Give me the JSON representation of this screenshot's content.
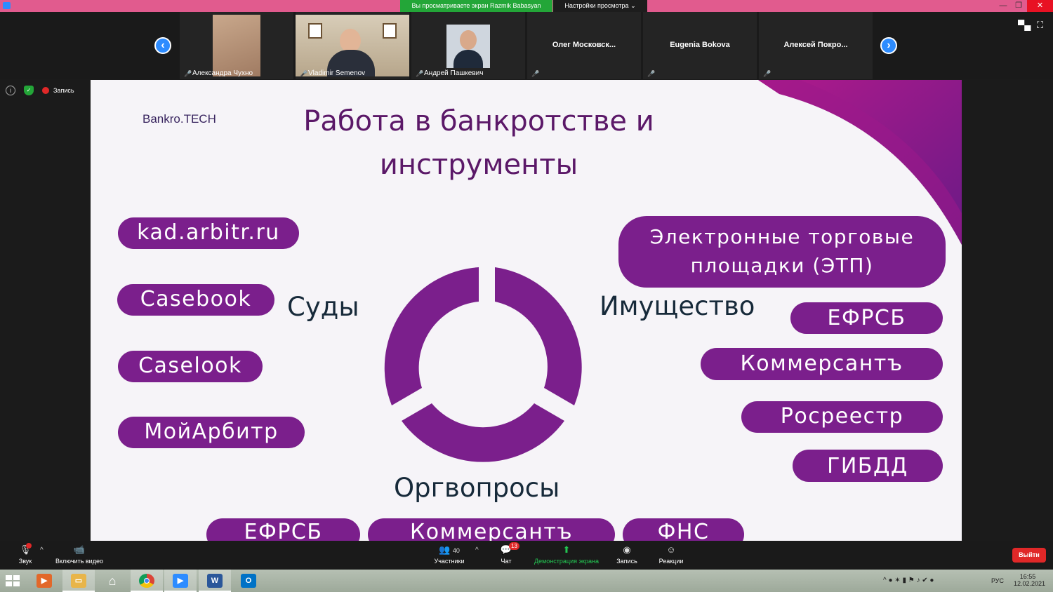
{
  "window": {
    "share_banner": "Вы просматриваете экран Razmik Babasyan",
    "view_options": "Настройки просмотра",
    "minimize": "—",
    "restore": "❐",
    "close": "✕"
  },
  "gallery": {
    "participants": [
      {
        "name": "Александра Чухно",
        "video": true
      },
      {
        "name": "Vladimir Semenov",
        "video": true
      },
      {
        "name": "Андрей Пашкевич",
        "video": true
      },
      {
        "name": "Олег  Московск...",
        "video": false
      },
      {
        "name": "Eugenia Bokova",
        "video": false
      },
      {
        "name": "Алексей  Покро...",
        "video": false
      }
    ]
  },
  "status": {
    "recording_label": "Запись"
  },
  "slide": {
    "logo": "Bankro.TECH",
    "title_line1": "Работа в банкротстве и",
    "title_line2": "инструменты",
    "courts_label": "Суды",
    "property_label": "Имущество",
    "org_label": "Оргвопросы",
    "courts_pills": [
      "kad.arbitr.ru",
      "Casebook",
      "Caselook",
      "МойАрбитр"
    ],
    "property_pills": [
      "Электронные торговые",
      "площадки (ЭТП)",
      "ЕФРСБ",
      "Коммерсантъ",
      "Росреестр",
      "ГИБДД"
    ],
    "org_pills": [
      "ЕФРСБ",
      "Коммерсантъ",
      "ФНС"
    ],
    "accent_color": "#7b1f8c"
  },
  "toolbar": {
    "audio": "Звук",
    "video": "Включить видео",
    "participants": "Участники",
    "participants_count": "40",
    "chat": "Чат",
    "chat_badge": "13",
    "share": "Демонстрация экрана",
    "record": "Запись",
    "reactions": "Реакции",
    "exit": "Выйти"
  },
  "taskbar": {
    "lang": "РУС",
    "time": "16:55",
    "date": "12.02.2021"
  }
}
